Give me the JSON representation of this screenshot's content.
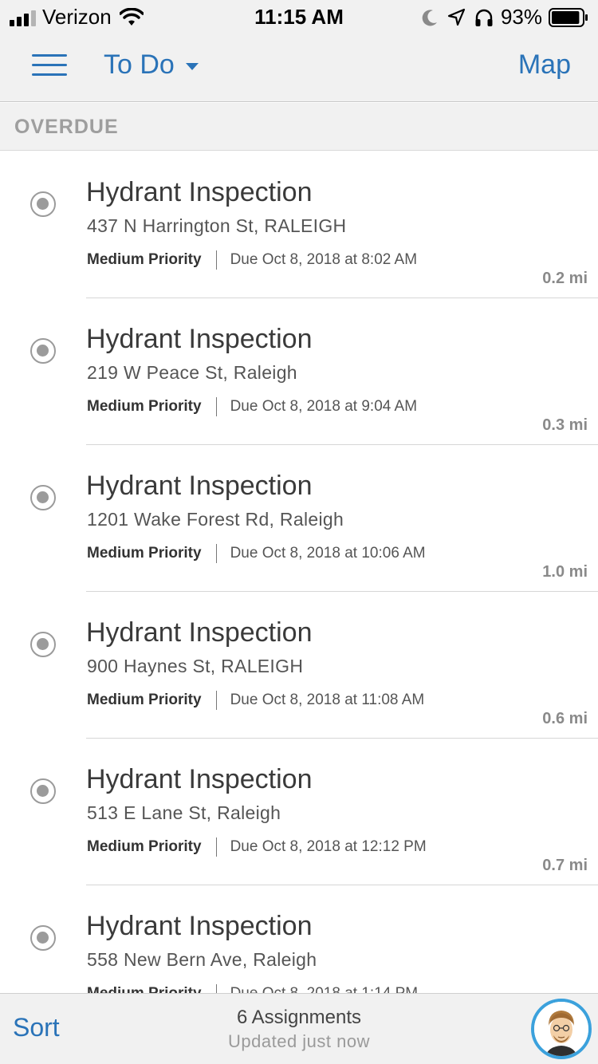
{
  "status_bar": {
    "carrier": "Verizon",
    "time": "11:15 AM",
    "battery": "93%",
    "battery_level": 0.93,
    "icons": [
      "signal-icon",
      "wifi-icon",
      "moon-icon",
      "location-icon",
      "headphones-icon",
      "battery-icon"
    ]
  },
  "nav": {
    "title": "To Do",
    "map_label": "Map",
    "icons": [
      "menu-icon",
      "chevron-down-icon"
    ]
  },
  "section": {
    "title": "OVERDUE"
  },
  "assignments": [
    {
      "title": "Hydrant Inspection",
      "address": "437 N Harrington St, RALEIGH",
      "priority": "Medium Priority",
      "due": "Due Oct 8, 2018 at 8:02 AM",
      "distance": "0.2 mi"
    },
    {
      "title": "Hydrant Inspection",
      "address": "219 W Peace St, Raleigh",
      "priority": "Medium Priority",
      "due": "Due Oct 8, 2018 at 9:04 AM",
      "distance": "0.3 mi"
    },
    {
      "title": "Hydrant Inspection",
      "address": "1201 Wake Forest Rd, Raleigh",
      "priority": "Medium Priority",
      "due": "Due Oct 8, 2018 at 10:06 AM",
      "distance": "1.0 mi"
    },
    {
      "title": "Hydrant Inspection",
      "address": "900 Haynes St, RALEIGH",
      "priority": "Medium Priority",
      "due": "Due Oct 8, 2018 at 11:08 AM",
      "distance": "0.6 mi"
    },
    {
      "title": "Hydrant Inspection",
      "address": "513 E Lane St, Raleigh",
      "priority": "Medium Priority",
      "due": "Due Oct 8, 2018 at 12:12 PM",
      "distance": "0.7 mi"
    },
    {
      "title": "Hydrant Inspection",
      "address": "558 New Bern Ave, Raleigh",
      "priority": "Medium Priority",
      "due": "Due Oct 8, 2018 at 1:14 PM",
      "distance": ""
    }
  ],
  "bottom_bar": {
    "sort_label": "Sort",
    "count": "6 Assignments",
    "updated": "Updated just now",
    "avatar_icon": "user-avatar-icon"
  },
  "colors": {
    "accent": "#2a73b8",
    "bar_background": "#f1f1f1",
    "avatar_ring": "#3ba1dc",
    "radio": "#9b9b9b"
  }
}
